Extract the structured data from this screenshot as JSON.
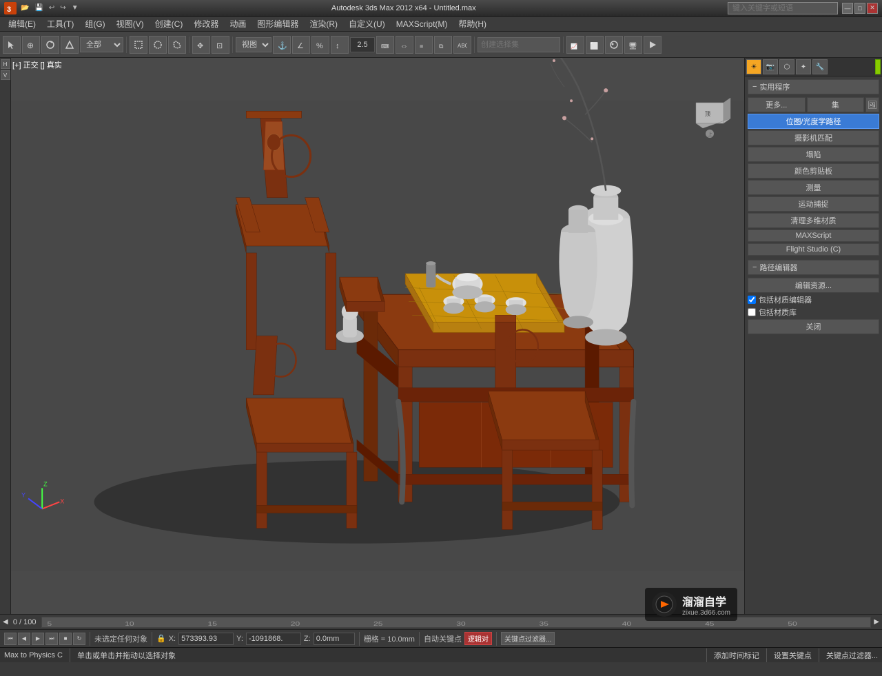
{
  "app": {
    "title": "Autodesk 3ds Max 2012 x64 - Untitled.max",
    "logo_text": "3",
    "search_placeholder": "键入关键字或短语"
  },
  "titlebar": {
    "minimize_label": "—",
    "restore_label": "□",
    "close_label": "✕"
  },
  "menubar": {
    "items": [
      {
        "label": "编辑(E)"
      },
      {
        "label": "工具(T)"
      },
      {
        "label": "组(G)"
      },
      {
        "label": "视图(V)"
      },
      {
        "label": "创建(C)"
      },
      {
        "label": "修改器"
      },
      {
        "label": "动画"
      },
      {
        "label": "图形编辑器"
      },
      {
        "label": "渲染(R)"
      },
      {
        "label": "自定义(U)"
      },
      {
        "label": "MAXScript(M)"
      },
      {
        "label": "帮助(H)"
      }
    ]
  },
  "toolbar": {
    "select_filter_label": "全部",
    "view_label": "视图",
    "zoom_value": "2.5",
    "selection_set_label": "创建选择集"
  },
  "viewport": {
    "label": "[+] 正交 [] 真实",
    "label_parts": [
      "[+]",
      "正交",
      "[]",
      "真实"
    ]
  },
  "right_panel": {
    "tabs": [
      {
        "label": "☀",
        "tooltip": "显示",
        "active": true
      },
      {
        "label": "📷",
        "tooltip": "摄影机"
      },
      {
        "label": "⬡",
        "tooltip": "几何"
      },
      {
        "label": "✦",
        "tooltip": "灯光"
      },
      {
        "label": "🔧",
        "tooltip": "工具"
      }
    ],
    "utility_section": {
      "header": "实用程序",
      "more_btn": "更多...",
      "set_btn": "集",
      "items": [
        {
          "label": "位图/光度学路径",
          "selected": true
        },
        {
          "label": "摄影机匹配"
        },
        {
          "label": "塌陷"
        },
        {
          "label": "颜色剪贴板"
        },
        {
          "label": "测量"
        },
        {
          "label": "运动捕捉"
        },
        {
          "label": "清理多维材质"
        },
        {
          "label": "MAXScript"
        },
        {
          "label": "Flight Studio (C)"
        }
      ]
    },
    "path_section": {
      "header": "路径编辑器",
      "edit_btn": "编辑资源...",
      "checkboxes": [
        {
          "label": "包括材质编辑器",
          "checked": true
        },
        {
          "label": "包括材质库",
          "checked": false
        }
      ],
      "close_btn": "关闭"
    }
  },
  "timeline": {
    "frame_current": "0",
    "frame_total": "100",
    "frame_display": "0 / 100"
  },
  "statusbar": {
    "no_selection": "未选定任何对象",
    "x_label": "X:",
    "x_value": "573393.93",
    "y_label": "Y:",
    "y_value": "-1091868.",
    "z_label": "Z:",
    "z_value": "0.0mm",
    "grid_label": "栅格 = 10.0mm",
    "auto_key_label": "自动关键点",
    "select_label": "逻辑对",
    "key_filter_label": "关键点过滤器..."
  },
  "bottom_status": {
    "left_text": "Max to Physics C",
    "status_text": "单击或单击并拖动以选择对象",
    "add_time_label": "添加时间标记",
    "set_key_label": "设置关键点",
    "filter_label": "关键点过滤器..."
  },
  "watermark": {
    "brand": "溜溜自学",
    "url": "zixue.3d66.com"
  }
}
